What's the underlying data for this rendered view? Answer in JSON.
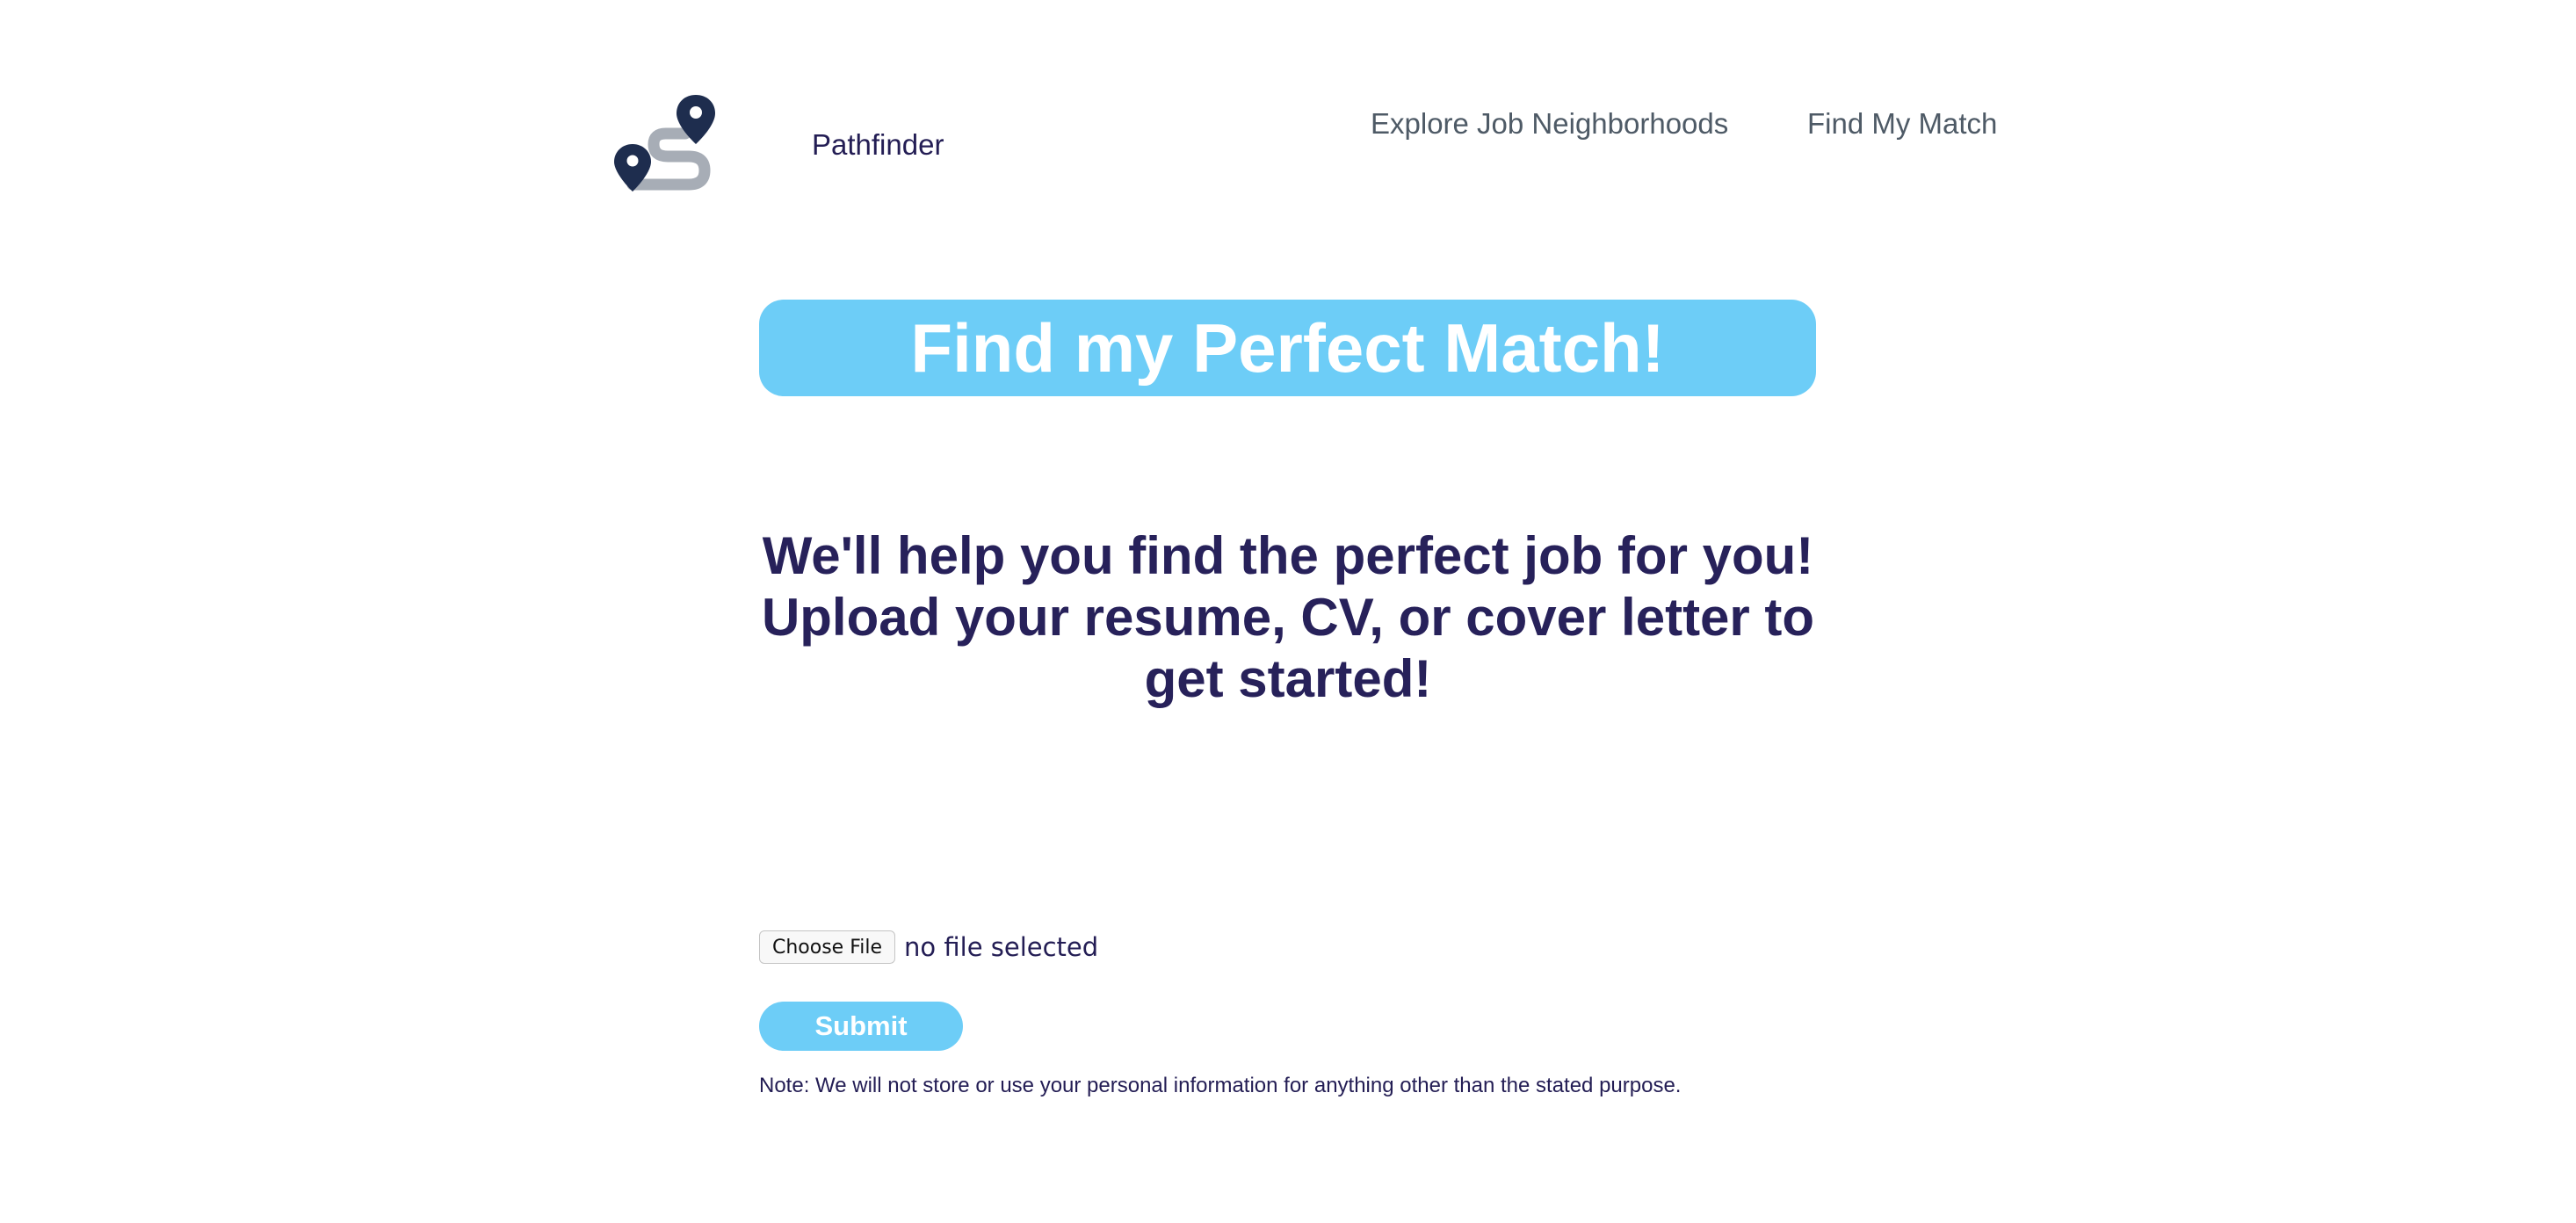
{
  "header": {
    "logo_icon": "map-route-pins-icon",
    "brand": "Pathfinder",
    "nav": [
      {
        "label": "Explore Job Neighborhoods"
      },
      {
        "label": "Find My Match"
      }
    ]
  },
  "banner": {
    "title": "Find my Perfect Match!"
  },
  "intro": {
    "line1": "We'll help you find the perfect job for you!",
    "line2": "Upload your resume, CV, or cover letter to get started!"
  },
  "upload": {
    "choose_label": "Choose File",
    "status": "no file selected"
  },
  "submit_label": "Submit",
  "note": "Note: We will not store or use your personal information for anything other than the stated purpose.",
  "colors": {
    "accent": "#6dcdf7",
    "heading": "#27215a",
    "nav_text": "#4e5a66",
    "logo_dark": "#1e2d4e",
    "logo_path": "#a7adb6"
  }
}
